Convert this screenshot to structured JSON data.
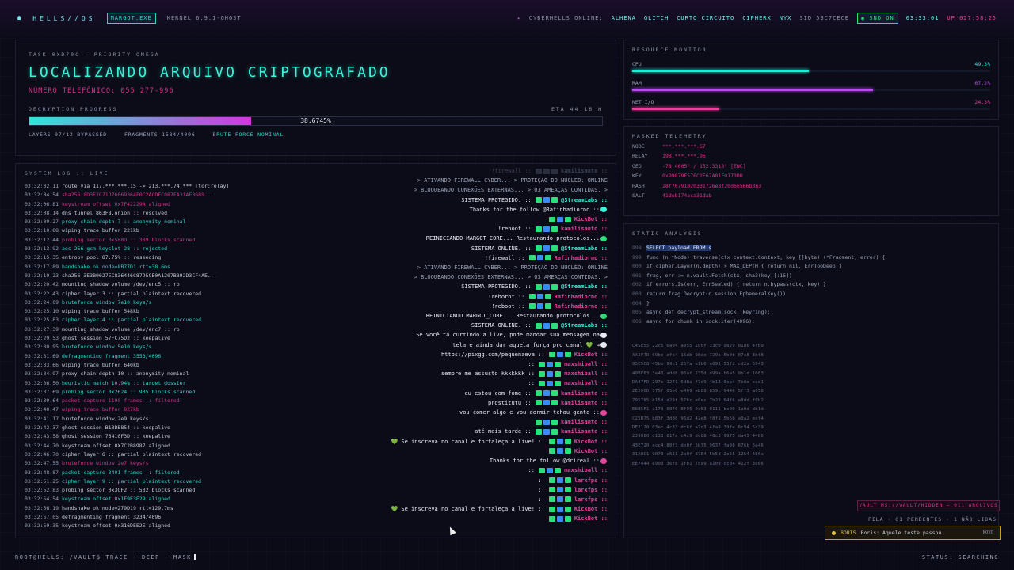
{
  "topbar": {
    "brand": "HELLS//OS",
    "user": "MARGOT.EXE",
    "kernel": "KERNEL 6.9.1-GHOST",
    "online_label": "CYBERHELLS ONLINE:",
    "online": [
      "ALHENA",
      "GLITCH",
      "CURTO_CIRCUITO",
      "CIPHERX",
      "NYX"
    ],
    "sid": "SID 53C7CECE",
    "snd": "SND ON",
    "clock": "03:33:01",
    "uptime": "UP 027:58:25"
  },
  "task": {
    "label": "TASK 0XD70C — PRIORITY OMEGA",
    "title": "LOCALIZANDO ARQUIVO CRIPTOGRAFADO",
    "phone": "NÚMERO TELEFÔNICO: 055 277-996",
    "progress_label": "DECRYPTION PROGRESS",
    "eta": "ETA 44.16 H",
    "progress": 0.386745,
    "progress_text": "38.6745%",
    "layers": "LAYERS 07/12 BYPASSED",
    "fragments": "FRAGMENTS 1584/4096",
    "bruteforce": "BRUTE-FORCE NOMINAL"
  },
  "log": {
    "label": "SYSTEM LOG :: LIVE",
    "lines": [
      {
        "t": "03:32:02.11",
        "m": "route via 117.***.***.15 -> 213.***.74.*** [tor:relay]",
        "c": "w"
      },
      {
        "t": "03:32:04.54",
        "m": "sha256 0D3E2C71D76069364F0C2ACDFC087FA31AE8689...",
        "c": "p"
      },
      {
        "t": "03:32:06.81",
        "m": "keystream offset 0x7F42229A aligned",
        "c": "p"
      },
      {
        "t": "03:32:08.14",
        "m": "dns tunnel 863F8.onion :: resolved",
        "c": "w"
      },
      {
        "t": "03:32:09.27",
        "m": "proxy chain depth 7 :: anonymity nominal",
        "c": "c"
      },
      {
        "t": "03:32:10.88",
        "m": "wiping trace buffer 221kb",
        "c": "w"
      },
      {
        "t": "03:32:12.44",
        "m": "probing sector 0x588D :: 389 blocks scanned",
        "c": "p"
      },
      {
        "t": "03:32:13.92",
        "m": "aes-256-gcm keyslot 28 :: rejected",
        "c": "c"
      },
      {
        "t": "03:32:15.35",
        "m": "entropy pool 87.75% :: reseeding",
        "c": "w"
      },
      {
        "t": "03:32:17.89",
        "m": "handshake ok node=8B77D1 rtt=38.6ms",
        "c": "c"
      },
      {
        "t": "03:32:19.23",
        "m": "sha256 3E3B0027EC836446C87959E0A1207B892D3CF4AE...",
        "c": "w"
      },
      {
        "t": "03:32:20.42",
        "m": "mounting shadow volume /dev/enc5 :: ro",
        "c": "w"
      },
      {
        "t": "03:32:22.43",
        "m": "cipher layer 3 :: partial plaintext recovered",
        "c": "w"
      },
      {
        "t": "03:32:24.09",
        "m": "bruteforce window 7e10 keys/s",
        "c": "c"
      },
      {
        "t": "03:32:25.10",
        "m": "wiping trace buffer 548kb",
        "c": "w"
      },
      {
        "t": "03:32:25.83",
        "m": "cipher layer 4 :: partial plaintext recovered",
        "c": "c"
      },
      {
        "t": "03:32:27.39",
        "m": "mounting shadow volume /dev/enc7 :: ro",
        "c": "w"
      },
      {
        "t": "03:32:29.53",
        "m": "ghost session 57FC75D2 :: keepalive",
        "c": "w"
      },
      {
        "t": "03:32:30.95",
        "m": "bruteforce window 5e10 keys/s",
        "c": "c"
      },
      {
        "t": "03:32:31.69",
        "m": "defragmenting fragment 3553/4096",
        "c": "c"
      },
      {
        "t": "03:32:33.66",
        "m": "wiping trace buffer 640kb",
        "c": "w"
      },
      {
        "t": "03:32:34.97",
        "m": "proxy chain depth 10 :: anonymity nominal",
        "c": "w"
      },
      {
        "t": "03:32:36.50",
        "m": "heuristic match 10.94% :: target dossier",
        "c": "c"
      },
      {
        "t": "03:32:37.69",
        "m": "probing sector 0x2624 :: 935 blocks scanned",
        "c": "c"
      },
      {
        "t": "03:32:39.64",
        "m": "packet capture 1190 frames :: filtered",
        "c": "p"
      },
      {
        "t": "03:32:40.47",
        "m": "wiping trace buffer 827kb",
        "c": "p"
      },
      {
        "t": "03:32:41.17",
        "m": "bruteforce window 2e9 keys/s",
        "c": "w"
      },
      {
        "t": "03:32:42.37",
        "m": "ghost session B13DB854 :: keepalive",
        "c": "w"
      },
      {
        "t": "03:32:43.58",
        "m": "ghost session 76410F3D :: keepalive",
        "c": "w"
      },
      {
        "t": "03:32:44.70",
        "m": "keystream offset 0X7C2B8987 aligned",
        "c": "w"
      },
      {
        "t": "03:32:46.70",
        "m": "cipher layer 6 :: partial plaintext recovered",
        "c": "w"
      },
      {
        "t": "03:32:47.55",
        "m": "bruteforce window 2e7 keys/s",
        "c": "p"
      },
      {
        "t": "03:32:48.87",
        "m": "packet capture 3401 frames :: filtered",
        "c": "c"
      },
      {
        "t": "03:32:51.25",
        "m": "cipher layer 9 :: partial plaintext recovered",
        "c": "c"
      },
      {
        "t": "03:32:52.83",
        "m": "probing sector 0x3CF2 :: 532 blocks scanned",
        "c": "w"
      },
      {
        "t": "03:32:54.54",
        "m": "keystream offset 0x1F9E3E29 aligned",
        "c": "c"
      },
      {
        "t": "03:32:56.19",
        "m": "handshake ok node=279D19 rtt=129.7ms",
        "c": "w"
      },
      {
        "t": "03:32:57.05",
        "m": "defragmenting fragment 3234/4096",
        "c": "w"
      },
      {
        "t": "03:32:59.35",
        "m": "keystream offset 0x316DEE2E aligned",
        "c": "w"
      }
    ]
  },
  "chat": [
    {
      "text": "!firewall :: ",
      "user": "kamilisanto ::",
      "ghost": true
    },
    {
      "sys": "> ATIVANDO FIREWALL CYBER... > PROTEÇÃO DO NÚCLEO: ONLINE"
    },
    {
      "sys": "> BLOQUEANDO CONEXÕES EXTERNAS... > 03 AMEAÇAS CONTIDAS. >"
    },
    {
      "text": "SISTEMA PROTEGIDO. ::",
      "user": "@StreamLabs ::",
      "uc": "#3ef0d8"
    },
    {
      "text": "Thanks for the follow @Rafinhadiorno ::",
      "user": "",
      "uc": "#3ef0d8"
    },
    {
      "text": "",
      "user": "KickBot ::",
      "uc": "#e0479d"
    },
    {
      "text": "!reboot ::",
      "user": "kamilisanto ::",
      "uc": "#e0479d"
    },
    {
      "text": "REINICIANDO MARGOT_CORE... Restaurando protocolos...",
      "user": "",
      "uc": "#2be07a"
    },
    {
      "text": "SISTEMA ONLINE. ::",
      "user": "@StreamLabs ::",
      "uc": "#3ef0d8"
    },
    {
      "text": "!firewall ::",
      "user": "Rafinhadiorno ::",
      "uc": "#e0479d"
    },
    {
      "sys": "> ATIVANDO FIREWALL CYBER... > PROTEÇÃO DO NÚCLEO: ONLINE"
    },
    {
      "sys": "> BLOQUEANDO CONEXÕES EXTERNAS... > 03 AMEAÇAS CONTIDAS. >"
    },
    {
      "text": "SISTEMA PROTEGIDO. ::",
      "user": "@StreamLabs ::",
      "uc": "#3ef0d8"
    },
    {
      "text": "!reborot ::",
      "user": "Rafinhadiorno ::",
      "uc": "#e0479d"
    },
    {
      "text": "!reboot ::",
      "user": "Rafinhadiorno ::",
      "uc": "#e0479d"
    },
    {
      "text": "REINICIANDO MARGOT_CORE... Restaurando protocolos...",
      "user": "",
      "uc": "#2be07a"
    },
    {
      "text": "SISTEMA ONLINE. ::",
      "user": "@StreamLabs ::",
      "uc": "#3ef0d8"
    },
    {
      "text": "Se você tá curtindo a live, pode mandar sua mensagem na",
      "user": "",
      "uc": "#e7eaf3"
    },
    {
      "text": "tela e ainda dar aquela força pro canal 💚 →",
      "user": "",
      "uc": "#e7eaf3"
    },
    {
      "text": "https://pixgg.com/pequenaeva ::",
      "user": "KickBot ::",
      "uc": "#e0479d"
    },
    {
      "text": "::",
      "user": "maxshiball ::",
      "uc": "#e0479d"
    },
    {
      "text": "sempre me assusto kkkkkkk ::",
      "user": "maxshiball ::",
      "uc": "#e0479d"
    },
    {
      "text": "::",
      "user": "maxshiball ::",
      "uc": "#e0479d"
    },
    {
      "text": "eu estou com fome ::",
      "user": "kamilisanto ::",
      "uc": "#e0479d"
    },
    {
      "text": "prostitutu ::",
      "user": "kamilisanto ::",
      "uc": "#e0479d"
    },
    {
      "text": "vou comer algo e vou dormir tchau gente ::",
      "user": "",
      "uc": "#e0479d"
    },
    {
      "text": "",
      "user": "kamilisanto ::",
      "uc": "#e0479d"
    },
    {
      "text": "até mais tarde ::",
      "user": "kamilisanto ::",
      "uc": "#e0479d"
    },
    {
      "text": "💚 Se inscreva no canal e fortaleça a live! ::",
      "user": "KickBot ::",
      "uc": "#e0479d"
    },
    {
      "text": "",
      "user": "KickBot ::",
      "uc": "#e0479d"
    },
    {
      "text": "Thanks for the follow @drireal ::",
      "user": "",
      "uc": "#e0479d"
    },
    {
      "text": "::",
      "user": "maxshiball ::",
      "uc": "#e0479d"
    },
    {
      "text": "::",
      "user": "larxfps ::",
      "uc": "#e0479d"
    },
    {
      "text": "::",
      "user": "larxfps ::",
      "uc": "#e0479d"
    },
    {
      "text": "::",
      "user": "larxfps ::",
      "uc": "#e0479d"
    },
    {
      "text": "💚 Se inscreva no canal e fortaleça a live! ::",
      "user": "KickBot ::",
      "uc": "#e0479d"
    },
    {
      "text": "",
      "user": "KickBot ::",
      "uc": "#e0479d"
    }
  ],
  "resources": {
    "label": "RESOURCE MONITOR",
    "items": [
      {
        "name": "CPU",
        "value": "49.3%",
        "frac": 0.493,
        "color": "#2be7d8"
      },
      {
        "name": "RAM",
        "value": "67.2%",
        "frac": 0.672,
        "color": "#b84cf0"
      },
      {
        "name": "NET I/O",
        "value": "24.3%",
        "frac": 0.243,
        "color": "#e0479d"
      }
    ]
  },
  "telemetry": {
    "label": "MASKED TELEMETRY",
    "rows": [
      {
        "k": "NODE",
        "v": "***.***.***.57"
      },
      {
        "k": "RELAY",
        "v": "198.***.***.96"
      },
      {
        "k": "GEO",
        "v": "-78.4605° / 152.3313° [ENC]"
      },
      {
        "k": "KEY",
        "v": "0x99879E576C2E67A81E0173DD"
      },
      {
        "k": "HASH",
        "v": "28f70791020331726e3f20d66566b363"
      },
      {
        "k": "SALT",
        "v": "41deb174aca31dab"
      }
    ]
  },
  "static": {
    "label": "STATIC ANALYSIS",
    "code": [
      {
        "n": "998",
        "t": "SELECT payload FROM s"
      },
      {
        "n": "999",
        "t": "func (n *Node) traverse(ctx context.Context, key []byte) (*Fragment, error) {"
      },
      {
        "n": "000",
        "t": "if cipher.Layer(n.depth) > MAX_DEPTH { return nil, ErrTooDeep }"
      },
      {
        "n": "001",
        "t": "frag, err := n.vault.Fetch(ctx, sha3(key)[:16])"
      },
      {
        "n": "002",
        "t": "if errors.Is(err, ErrSealed) { return n.bypass(ctx, key) }"
      },
      {
        "n": "003",
        "t": "return frag.Decrypt(n.session.EphemeralKey())"
      },
      {
        "n": "004",
        "t": "}"
      },
      {
        "n": "005",
        "t": "async def decrypt_stream(sock, keyring):"
      },
      {
        "n": "006",
        "t": "async for chunk in sock.iter(4096):"
      }
    ],
    "hex": [
      "C4SE55 22c5 6a04 ae55 2d0f 33c0 9829 0186 4fb0",
      "AA2F7D 09bc efb4 15db 98de 729a 5b0b 07c8 3bf8",
      "95E5C8 45bb 99c1 257a e1b6 a091 53f2 cd2a 0943",
      "40BF63 3e40 add8 96af 235d d99a b6a5 9b1d 1063",
      "DA47FD 297c 1271 6d8a f7d9 4b13 9ca4 7b8e cae1",
      "2E200D 775f 05e0 e409 eb09 859c 9446 5ff3 a658",
      "795785 b15d d29f 576c e0ec 7b23 64f6 a8dd f0b2",
      "E6B5F1 a179 0876 8f95 0c53 0111 bc00 1a0d db1d",
      "C25B75 b83f 3d80 96d2 42e8 f8f1 5b5b a0a2 eaf4",
      "DE2120 03ec 4c33 dc6f a7d3 4fa9 39fe 6c94 5c39",
      "239080 d133 817a c4c9 dc88 48c3 9975 da45 4486",
      "43E720 acc4 80f3 db0f 5b75 9637 fa98 676b 6a46",
      "31A0C1 9070 c521 2a0f 8784 5b5d 2c55 1254 486a",
      "EE7444 e903 36f8 1fb1 7ca9 a109 cc04 412f 3066"
    ]
  },
  "vault": "VAULT MS://VAULT/HIDDEN — 011 ARQUIVOS",
  "fila": "FILA · 01 PENDENTES · 1 NÃO LIDAS",
  "toast": {
    "name": "BORIS",
    "msg": "Boris: Aquele teste passou.",
    "tag": "NOVO"
  },
  "bottom": {
    "prompt": "ROOT@HELLS:~/VAULT$ TRACE --DEEP --MASK",
    "status": "STATUS: SEARCHING"
  }
}
